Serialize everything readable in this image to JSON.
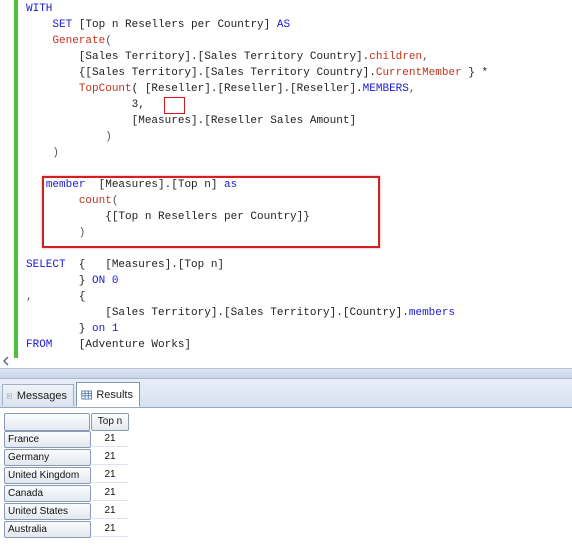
{
  "editor": {
    "lines": [
      {
        "parts": [
          {
            "t": "WITH",
            "c": "kw"
          }
        ]
      },
      {
        "parts": [
          {
            "t": "    ",
            "c": "op"
          },
          {
            "t": "SET",
            "c": "kw"
          },
          {
            "t": " [Top n Resellers per Country] ",
            "c": "id"
          },
          {
            "t": "AS",
            "c": "kw"
          }
        ]
      },
      {
        "parts": [
          {
            "t": "    ",
            "c": "op"
          },
          {
            "t": "Generate",
            "c": "fn"
          },
          {
            "t": "(",
            "c": "op"
          }
        ]
      },
      {
        "parts": [
          {
            "t": "        [Sales Territory].[Sales Territory Country].",
            "c": "id"
          },
          {
            "t": "children",
            "c": "fn"
          },
          {
            "t": ",",
            "c": "op"
          }
        ]
      },
      {
        "parts": [
          {
            "t": "        {[Sales Territory].[Sales Territory Country].",
            "c": "id"
          },
          {
            "t": "CurrentMember",
            "c": "fn"
          },
          {
            "t": " } *",
            "c": "id"
          }
        ]
      },
      {
        "parts": [
          {
            "t": "        ",
            "c": "op"
          },
          {
            "t": "TopCount",
            "c": "fn"
          },
          {
            "t": "( [Reseller].[Reseller].[Reseller].",
            "c": "id"
          },
          {
            "t": "MEMBERS",
            "c": "kw"
          },
          {
            "t": ",",
            "c": "op"
          }
        ]
      },
      {
        "parts": [
          {
            "t": "                ",
            "c": "op"
          },
          {
            "t": "3,",
            "c": "num"
          }
        ]
      },
      {
        "parts": [
          {
            "t": "                [Measures].[Reseller Sales Amount]",
            "c": "id"
          }
        ]
      },
      {
        "parts": [
          {
            "t": "            )",
            "c": "op"
          }
        ]
      },
      {
        "parts": [
          {
            "t": "    )",
            "c": "op"
          }
        ]
      },
      {
        "parts": [
          {
            "t": "",
            "c": "op"
          }
        ]
      },
      {
        "parts": [
          {
            "t": "   ",
            "c": "op"
          },
          {
            "t": "member",
            "c": "kw"
          },
          {
            "t": "  [Measures].[Top n] ",
            "c": "id"
          },
          {
            "t": "as",
            "c": "kw"
          }
        ]
      },
      {
        "parts": [
          {
            "t": "        ",
            "c": "op"
          },
          {
            "t": "count",
            "c": "fn"
          },
          {
            "t": "(",
            "c": "op"
          }
        ]
      },
      {
        "parts": [
          {
            "t": "            {[Top n Resellers per Country]}",
            "c": "id"
          }
        ]
      },
      {
        "parts": [
          {
            "t": "        )",
            "c": "op"
          }
        ]
      },
      {
        "parts": [
          {
            "t": "",
            "c": "op"
          }
        ]
      },
      {
        "parts": [
          {
            "t": "SELECT",
            "c": "kw"
          },
          {
            "t": "  {   [Measures].[Top n]",
            "c": "id"
          }
        ]
      },
      {
        "parts": [
          {
            "t": "        } ",
            "c": "id"
          },
          {
            "t": "ON 0",
            "c": "kw"
          }
        ]
      },
      {
        "parts": [
          {
            "t": ",",
            "c": "op"
          },
          {
            "t": "       {",
            "c": "id"
          }
        ]
      },
      {
        "parts": [
          {
            "t": "            [Sales Territory].[Sales Territory].[Country].",
            "c": "id"
          },
          {
            "t": "members",
            "c": "kw"
          }
        ]
      },
      {
        "parts": [
          {
            "t": "        } ",
            "c": "id"
          },
          {
            "t": "on 1",
            "c": "kw"
          }
        ]
      },
      {
        "parts": [
          {
            "t": "FROM",
            "c": "kw"
          },
          {
            "t": "    [Adventure Works]",
            "c": "id"
          }
        ]
      }
    ]
  },
  "tabs": {
    "messages": "Messages",
    "results": "Results"
  },
  "grid": {
    "column_header": "Top n",
    "rows": [
      {
        "label": "France",
        "value": "21"
      },
      {
        "label": "Germany",
        "value": "21"
      },
      {
        "label": "United Kingdom",
        "value": "21"
      },
      {
        "label": "Canada",
        "value": "21"
      },
      {
        "label": "United States",
        "value": "21"
      },
      {
        "label": "Australia",
        "value": "21"
      }
    ]
  },
  "colors": {
    "keyword": "#1a1ad6",
    "function": "#c0341c",
    "highlight_box": "#d02020",
    "change_bar": "#4cbf3c"
  }
}
